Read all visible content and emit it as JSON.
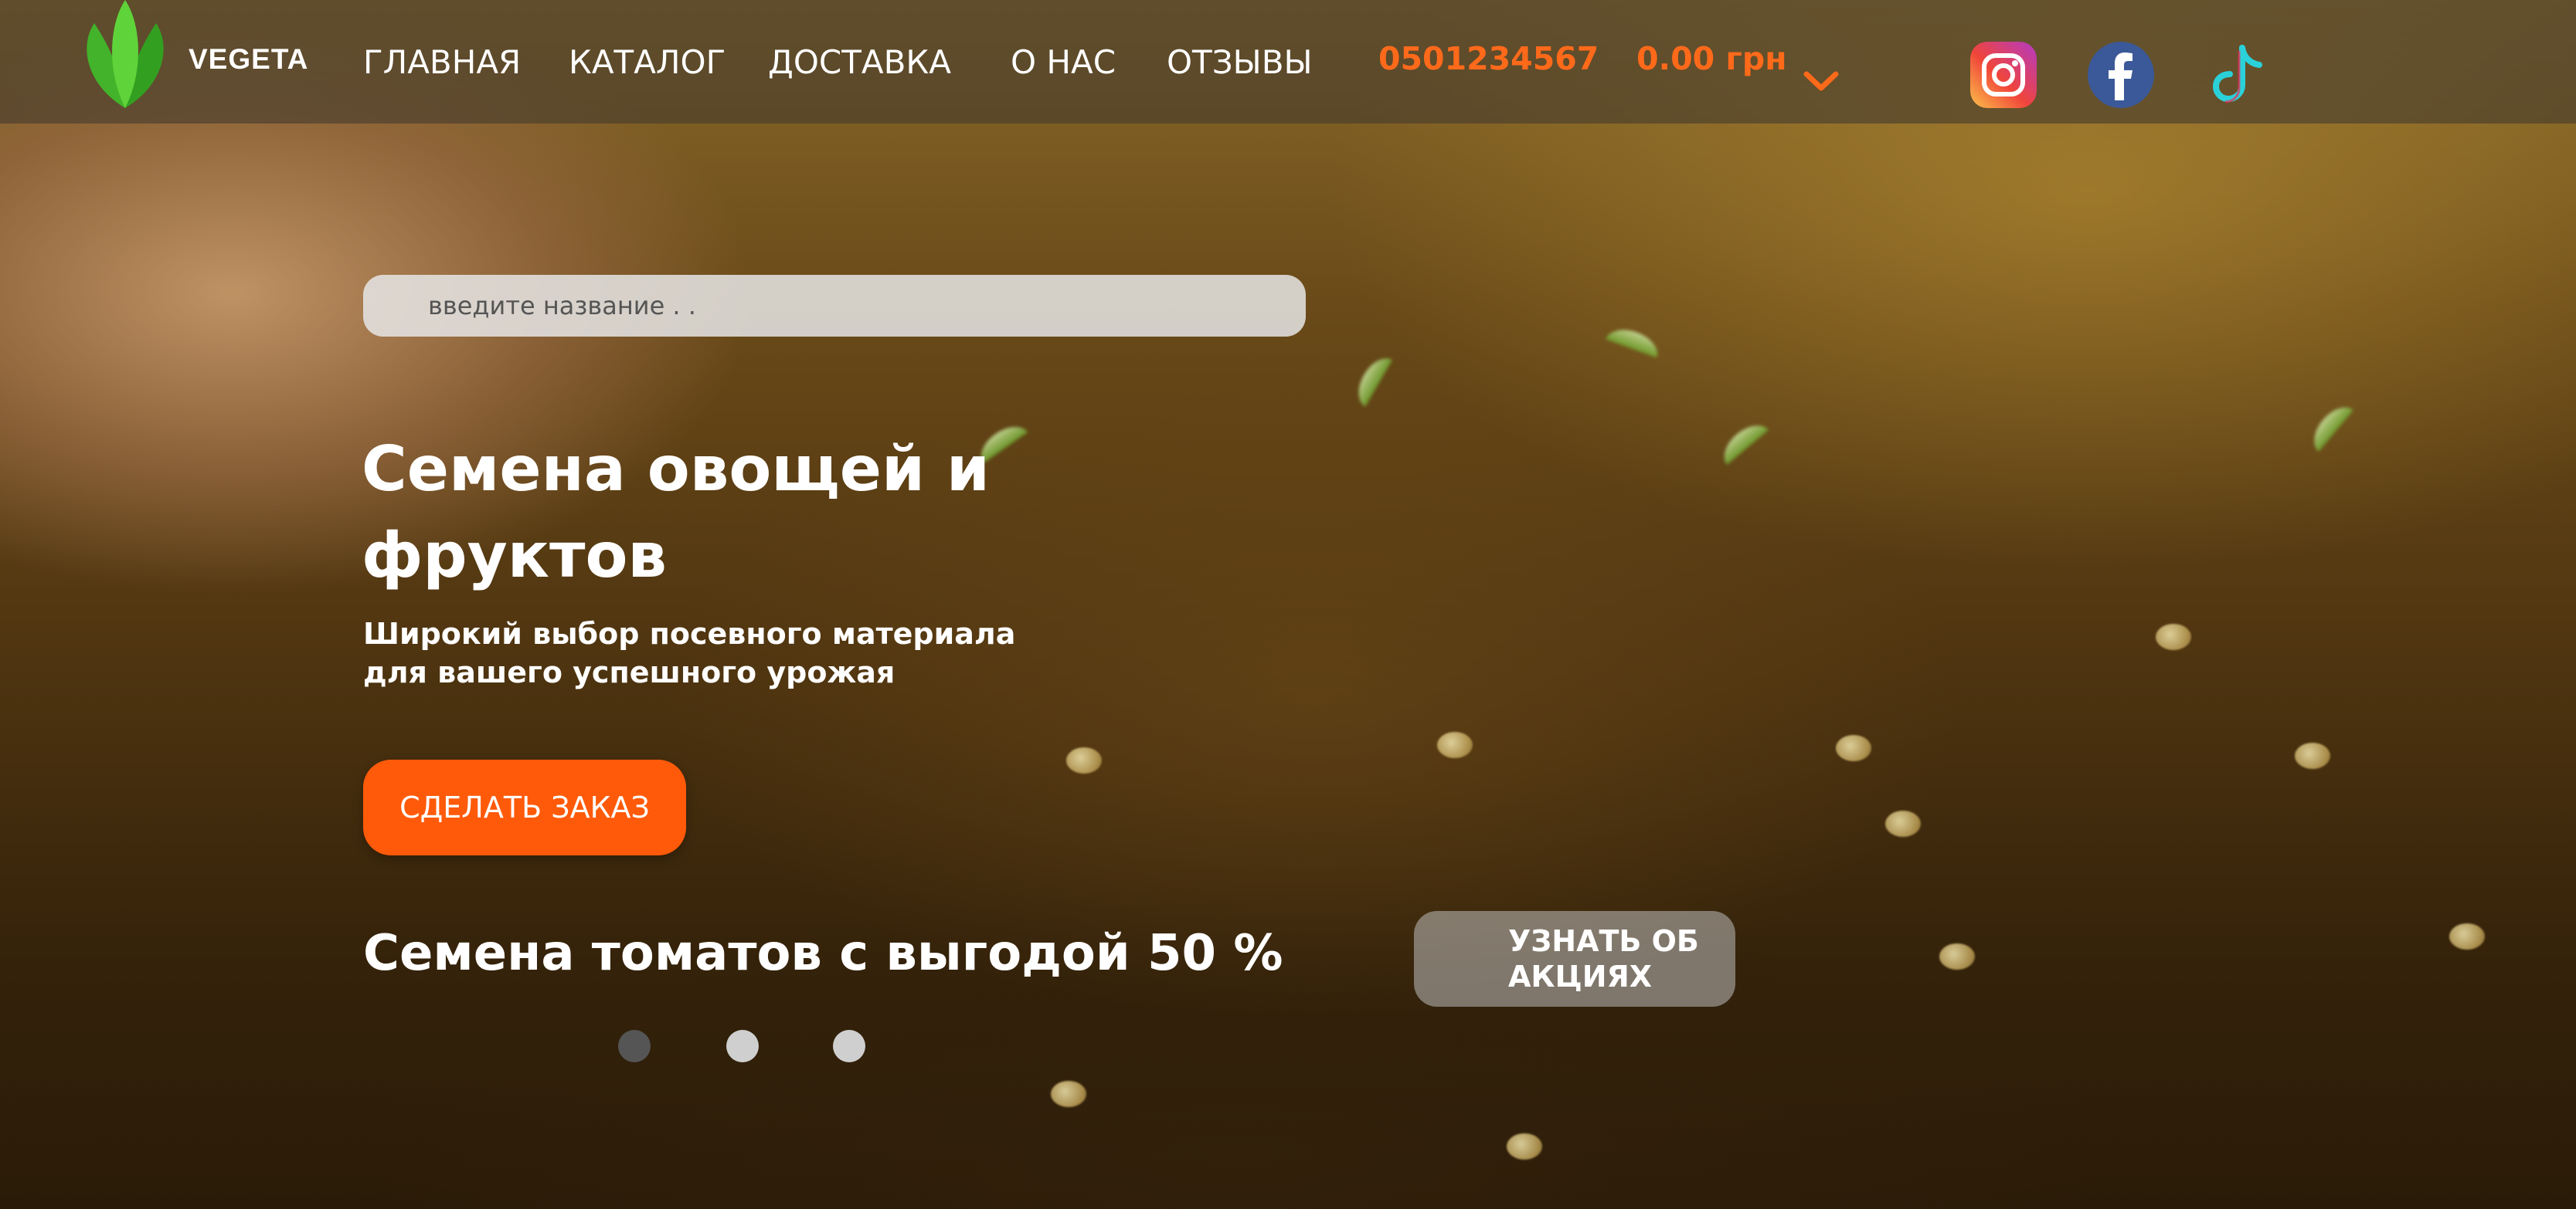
{
  "header": {
    "brand": "VEGETA",
    "nav": [
      {
        "label": "ГЛАВНАЯ"
      },
      {
        "label": "КАТАЛОГ"
      },
      {
        "label": "ДОСТАВКА"
      },
      {
        "label": "О НАС"
      },
      {
        "label": "ОТЗЫВЫ"
      }
    ],
    "phone": "0501234567",
    "cart_total": "0.00 грн",
    "cart_icon": "chevron-down-icon",
    "socials": [
      {
        "name": "instagram-icon"
      },
      {
        "name": "facebook-icon"
      },
      {
        "name": "tiktok-icon"
      }
    ]
  },
  "search": {
    "placeholder": "введите название . ."
  },
  "hero": {
    "title": "Семена овощей и фруктов",
    "subtitle_line1": "Широкий выбор посевного материала",
    "subtitle_line2": "для вашего успешного урожая",
    "cta": "СДЕЛАТЬ ЗАКАЗ"
  },
  "promo": {
    "text": "Семена томатов с выгодой 50 %",
    "button_line1": "УЗНАТЬ ОБ",
    "button_line2": "АКЦИЯХ"
  },
  "carousel": {
    "slide_count": 3,
    "active_slide": 1
  },
  "colors": {
    "accent": "#ff5a0a",
    "phone": "#ff6a1a",
    "dot_active": "#555555",
    "dot_inactive": "#cfcfcf"
  }
}
